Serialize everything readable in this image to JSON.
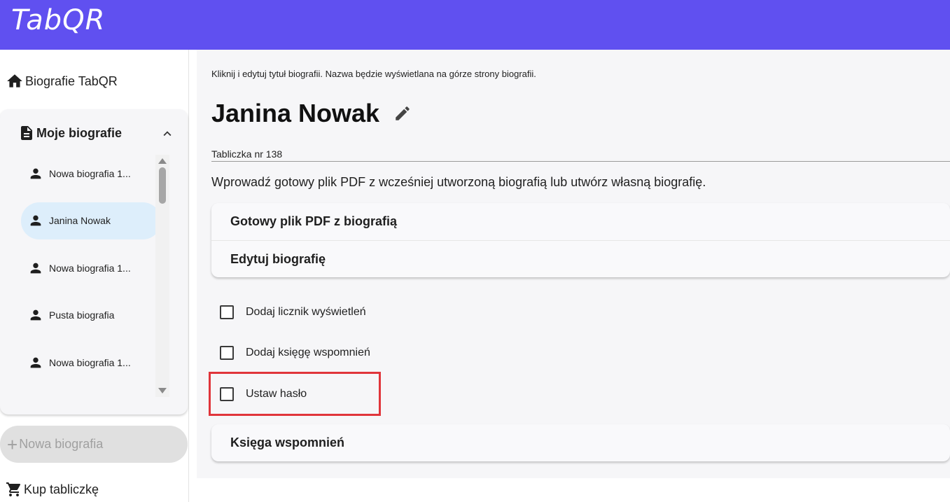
{
  "app": {
    "logo": "TabQR"
  },
  "sidebar": {
    "home_label": "Biografie TabQR",
    "my_bios_label": "Moje biografie",
    "items": [
      {
        "label": "Nowa biografia 1...",
        "active": false
      },
      {
        "label": "Janina Nowak",
        "active": true
      },
      {
        "label": "Nowa biografia 1...",
        "active": false
      },
      {
        "label": "Pusta biografia",
        "active": false
      },
      {
        "label": "Nowa biografia 1...",
        "active": false
      }
    ],
    "new_bio_label": "Nowa biografia",
    "buy_label": "Kup tabliczkę"
  },
  "main": {
    "hint": "Kliknij i edytuj tytuł biografii. Nazwa będzie wyświetlana na górze strony biografii.",
    "title": "Janina Nowak",
    "plate": "Tabliczka nr 138",
    "intro": "Wprowadź gotowy plik PDF z wcześniej utworzoną biografią lub utwórz własną biografię.",
    "pdf_section": "Gotowy plik PDF z biografią",
    "edit_section": "Edytuj biografię",
    "options": {
      "counter": "Dodaj licznik wyświetleń",
      "guestbook": "Dodaj księgę wspomnień",
      "password": "Ustaw hasło"
    },
    "guestbook_section": "Księga wspomnień"
  },
  "colors": {
    "appbar": "#6050f0",
    "active_item": "#ddeefb",
    "highlight": "#e0353b"
  }
}
